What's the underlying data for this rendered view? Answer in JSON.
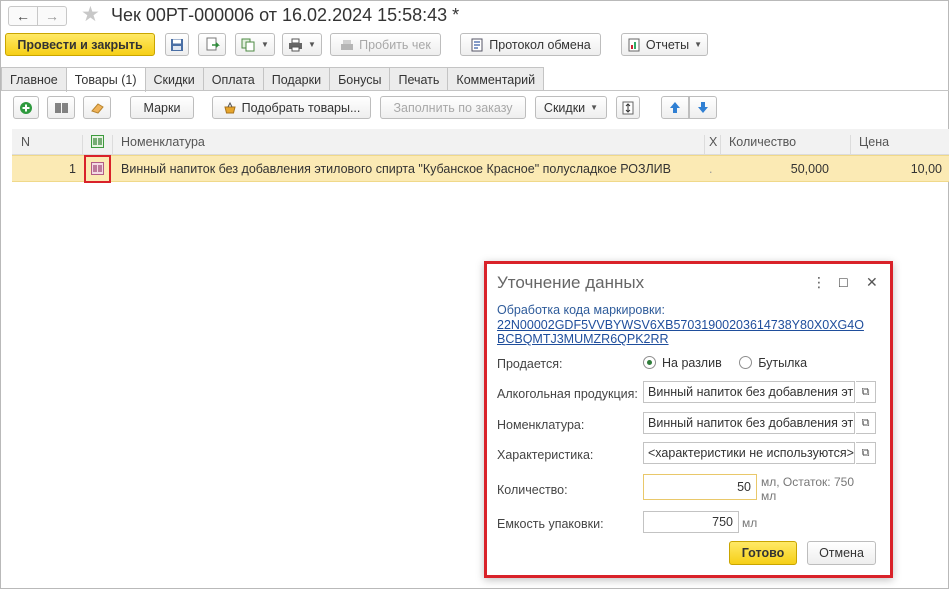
{
  "window": {
    "title": "Чек 00РТ-000006 от 16.02.2024 15:58:43 *"
  },
  "command_bar": {
    "post_and_close": "Провести и закрыть",
    "print_check": "Пробить чек",
    "exchange_log": "Протокол обмена",
    "reports": "Отчеты"
  },
  "tabs": [
    {
      "label": "Главное"
    },
    {
      "label": "Товары (1)",
      "active": true
    },
    {
      "label": "Скидки"
    },
    {
      "label": "Оплата"
    },
    {
      "label": "Подарки"
    },
    {
      "label": "Бонусы"
    },
    {
      "label": "Печать"
    },
    {
      "label": "Комментарий"
    }
  ],
  "table_toolbar": {
    "marks": "Марки",
    "pick_goods": "Подобрать товары...",
    "fill_by_order": "Заполнить по заказу",
    "discounts": "Скидки"
  },
  "grid": {
    "columns": {
      "n": "N",
      "item": "Номенклатура",
      "x": "Х",
      "qty": "Количество",
      "price": "Цена"
    },
    "rows": [
      {
        "n": "1",
        "item": "Винный напиток без добавления этилового спирта \"Кубанское Красное\" полусладкое РОЗЛИВ",
        "x": ".",
        "qty": "50,000",
        "price": "10,00"
      }
    ]
  },
  "dialog": {
    "title": "Уточнение данных",
    "subtitle": "Обработка кода маркировки:",
    "code_line1": "22N00002GDF5VVBYWSV6XB5703190020361473​8Y80X0XG4O",
    "code_line2": "BCBQMTJ3MUMZR6QPK2RR",
    "sold_label": "Продается:",
    "sold_options": [
      "На разлив",
      "Бутылка"
    ],
    "sold_selected": "На разлив",
    "alcohol_label": "Алкогольная продукция:",
    "alcohol_value": "Винный напиток без добавления этилового спирта",
    "item_label": "Номенклатура:",
    "item_value": "Винный напиток без добавления этилового спирта",
    "characteristic_label": "Характеристика:",
    "characteristic_value": "<характеристики не используются>",
    "qty_label": "Количество:",
    "qty_value": "50",
    "qty_unit": "мл, Остаток: 750",
    "qty_unit2": "мл",
    "capacity_label": "Емкость упаковки:",
    "capacity_value": "750",
    "capacity_unit": "мл",
    "ok_button": "Готово",
    "cancel_button": "Отмена"
  },
  "colors": {
    "primary_button": "#f6cf17",
    "selected_row": "#fbeab4",
    "highlight_border": "#d9222a",
    "link": "#1f4e9c"
  }
}
